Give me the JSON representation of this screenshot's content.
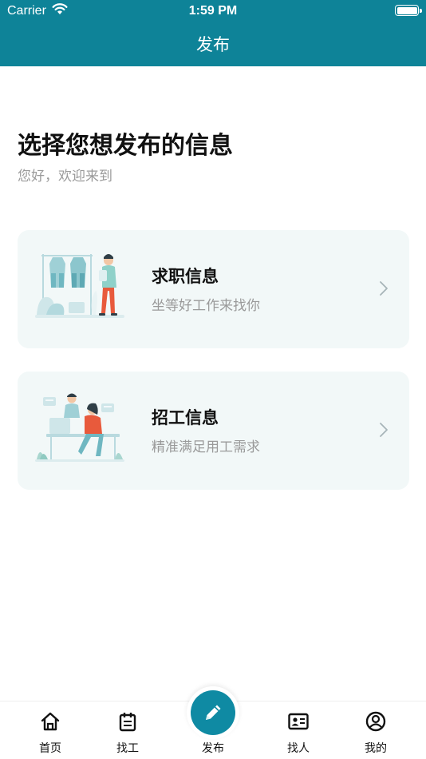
{
  "status_bar": {
    "carrier": "Carrier",
    "time": "1:59 PM"
  },
  "nav": {
    "title": "发布"
  },
  "intro": {
    "heading": "选择您想发布的信息",
    "subheading": "您好，欢迎来到"
  },
  "cards": [
    {
      "title": "求职信息",
      "description": "坐等好工作来找你",
      "illustration": "job-seeker-illustration"
    },
    {
      "title": "招工信息",
      "description": "精准满足用工需求",
      "illustration": "recruiter-illustration"
    }
  ],
  "tabbar": {
    "items": [
      {
        "label": "首页",
        "icon": "home-icon"
      },
      {
        "label": "找工",
        "icon": "calendar-icon"
      },
      {
        "label": "发布",
        "icon": "pencil-icon"
      },
      {
        "label": "找人",
        "icon": "id-card-icon"
      },
      {
        "label": "我的",
        "icon": "profile-icon"
      }
    ]
  },
  "colors": {
    "primary": "#0e8398",
    "card_bg": "#f2f8f8",
    "muted_text": "#9a9a9a",
    "accent": "#e85a3c"
  }
}
